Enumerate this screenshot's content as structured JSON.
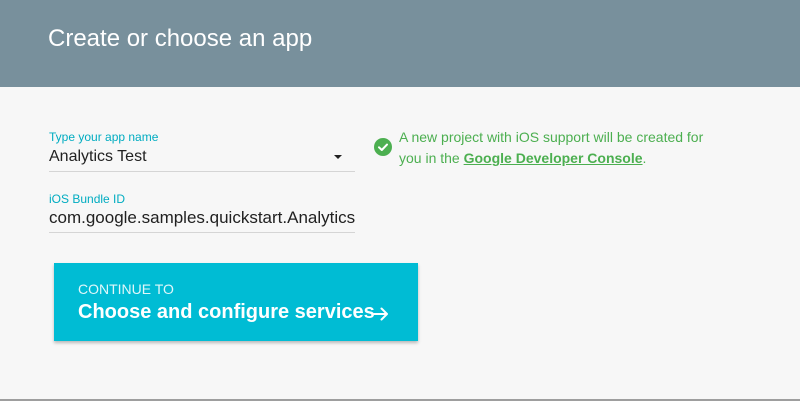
{
  "header": {
    "title": "Create or choose an app"
  },
  "form": {
    "app_name_label": "Type your app name",
    "app_name_value": "Analytics Test",
    "bundle_label": "iOS Bundle ID",
    "bundle_value": "com.google.samples.quickstart.AnalyticsExample"
  },
  "info": {
    "icon": "check-circle-icon",
    "text_before": "A new project with iOS support will be created for you in the ",
    "link_text": "Google Developer Console",
    "text_after": "."
  },
  "continue_button": {
    "small_label": "CONTINUE TO",
    "main_label": "Choose and configure services",
    "icon": "arrow-right-icon"
  },
  "colors": {
    "header_bg": "#78909c",
    "accent": "#00bcd4",
    "success": "#4caf50",
    "label": "#00acc1"
  }
}
